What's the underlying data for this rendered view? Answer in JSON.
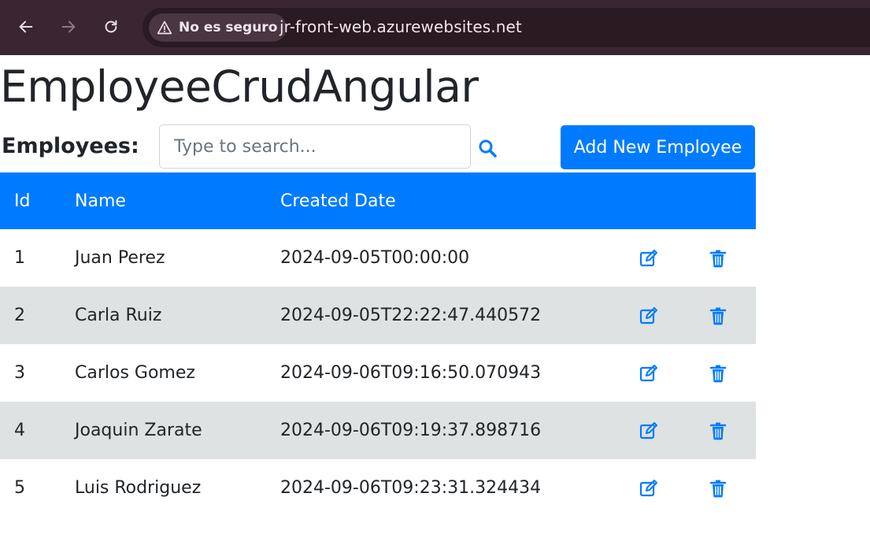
{
  "browser": {
    "security_label": "No es seguro",
    "url": "jr-front-web.azurewebsites.net",
    "icons": [
      "back-icon",
      "forward-icon",
      "reload-icon",
      "warning-icon"
    ]
  },
  "page": {
    "title": "EmployeeCrudAngular",
    "employees_label": "Employees:",
    "search_placeholder": "Type to search...",
    "add_button": "Add New Employee"
  },
  "table": {
    "headers": {
      "id": "Id",
      "name": "Name",
      "created": "Created Date"
    },
    "rows": [
      {
        "id": "1",
        "name": "Juan Perez",
        "created": "2024-09-05T00:00:00"
      },
      {
        "id": "2",
        "name": "Carla Ruiz",
        "created": "2024-09-05T22:22:47.440572"
      },
      {
        "id": "3",
        "name": "Carlos Gomez",
        "created": "2024-09-06T09:16:50.070943"
      },
      {
        "id": "4",
        "name": "Joaquin Zarate",
        "created": "2024-09-06T09:19:37.898716"
      },
      {
        "id": "5",
        "name": "Luis Rodriguez",
        "created": "2024-09-06T09:23:31.324434"
      }
    ],
    "row_icons": [
      "edit-icon",
      "trash-icon"
    ]
  },
  "colors": {
    "accent": "#007bff",
    "striped_row": "#dee2e2",
    "browser_chrome": "#3a2530"
  }
}
